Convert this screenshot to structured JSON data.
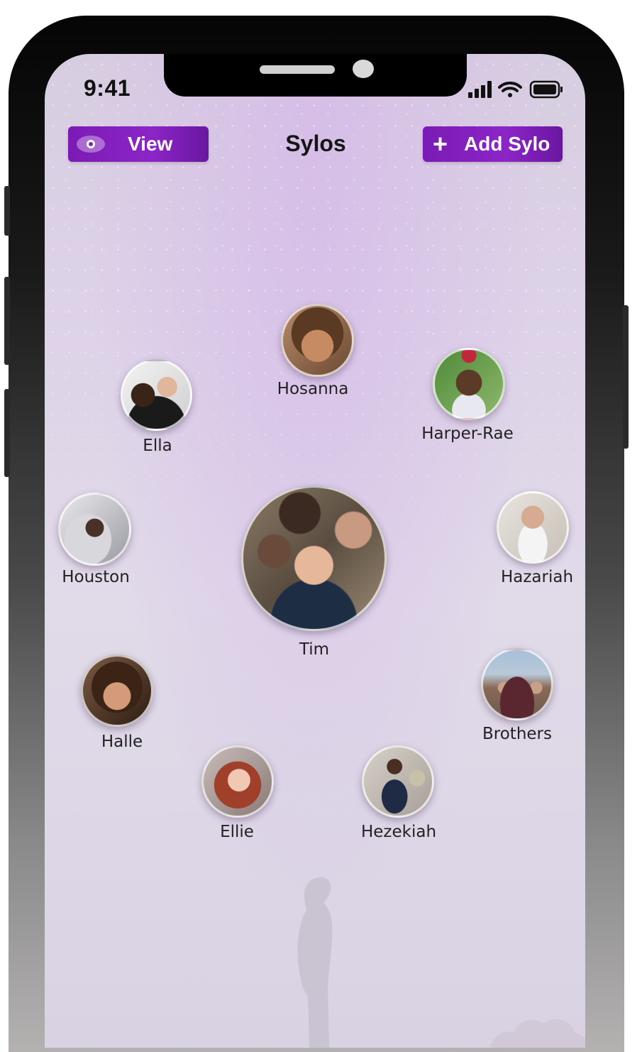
{
  "status_bar": {
    "time": "9:41"
  },
  "header": {
    "title": "Sylos",
    "view_button": {
      "label": "View",
      "icon": "eye-icon"
    },
    "add_button": {
      "label": "Add Sylo",
      "icon": "plus-icon"
    }
  },
  "colors": {
    "accent": "#8a22c4",
    "background": "#ddd4e8",
    "frame": "#0a0a0a"
  },
  "sylos": {
    "center": {
      "name": "Tim"
    },
    "hosanna": {
      "name": "Hosanna"
    },
    "ella": {
      "name": "Ella"
    },
    "harper_rae": {
      "name": "Harper-Rae"
    },
    "houston": {
      "name": "Houston"
    },
    "hazariah": {
      "name": "Hazariah"
    },
    "halle": {
      "name": "Halle"
    },
    "brothers": {
      "name": "Brothers"
    },
    "ellie": {
      "name": "Ellie"
    },
    "hezekiah": {
      "name": "Hezekiah"
    }
  }
}
